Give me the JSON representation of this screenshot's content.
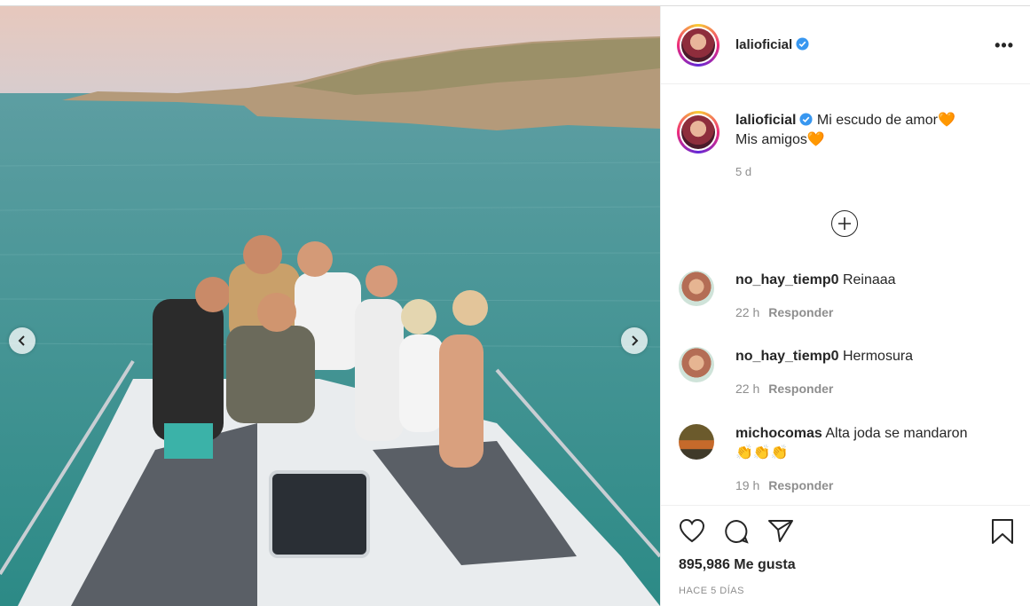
{
  "post": {
    "username": "lalioficial",
    "caption_line1": "Mi escudo de amor",
    "caption_line2": "Mis amigos",
    "caption_emoji": "🧡",
    "caption_time": "5 d",
    "likes": "895,986 Me gusta",
    "posted_ago": "HACE 5 DÍAS"
  },
  "comments": [
    {
      "username": "no_hay_tiemp0",
      "text": "Reinaaa",
      "time": "22 h",
      "reply": "Responder"
    },
    {
      "username": "no_hay_tiemp0",
      "text": "Hermosura",
      "time": "22 h",
      "reply": "Responder"
    },
    {
      "username": "michocomas",
      "text": "Alta joda se mandaron",
      "text2": "👏👏👏",
      "time": "19 h",
      "reply": "Responder"
    }
  ],
  "icons": {
    "prev": "chevron-left-icon",
    "next": "chevron-right-icon",
    "more": "more-options-icon",
    "add": "add-comment-icon",
    "like": "heart-icon",
    "comment": "comment-icon",
    "share": "send-icon",
    "save": "bookmark-icon",
    "verified": "verified-badge-icon"
  },
  "colors": {
    "verified": "#3897f0",
    "heart_emoji": "#f5701b",
    "muted": "#8e8e8e"
  }
}
